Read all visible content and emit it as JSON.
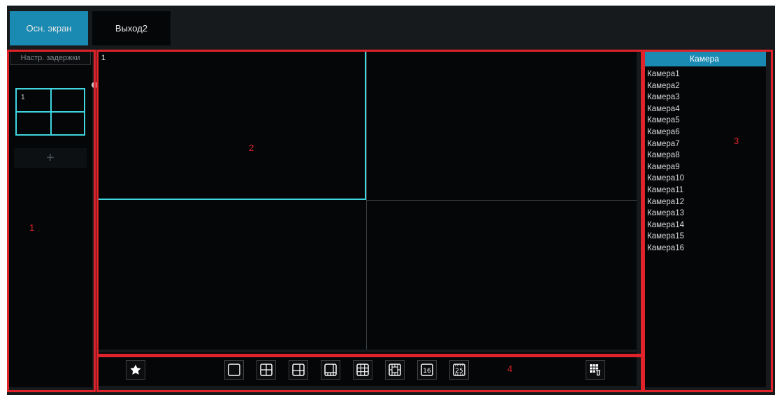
{
  "tabs": [
    {
      "label": "Осн. экран",
      "active": true
    },
    {
      "label": "Выход2",
      "active": false
    }
  ],
  "left_panel": {
    "delay_button": "Настр. задержки",
    "layout_thumb_number": "1",
    "add_icon": "plus-icon",
    "remove_icon": "close-icon"
  },
  "video": {
    "layout": "2x2",
    "cells": [
      {
        "number": "1",
        "selected": true
      },
      {
        "number": "",
        "selected": false
      },
      {
        "number": "",
        "selected": false
      },
      {
        "number": "",
        "selected": false
      }
    ]
  },
  "camera_panel": {
    "header": "Камера",
    "cameras": [
      "Камера1",
      "Камера2",
      "Камера3",
      "Камера4",
      "Камера5",
      "Камера6",
      "Камера7",
      "Камера8",
      "Камера9",
      "Камера10",
      "Камера11",
      "Камера12",
      "Камера13",
      "Камера14",
      "Камера15",
      "Камера16"
    ]
  },
  "toolbar": {
    "buttons": [
      "star-icon",
      "layout-1-icon",
      "layout-4-icon",
      "layout-6-icon",
      "layout-8-icon",
      "layout-9-icon",
      "layout-13-icon",
      "layout-16-icon",
      "layout-25-icon",
      "clear-icon"
    ],
    "layout16_label": "16",
    "layout25_label": "25"
  },
  "annotations": {
    "label1": "1",
    "label2": "2",
    "label3": "3",
    "label4": "4"
  },
  "colors": {
    "accent": "#1a8ab3",
    "selection": "#3fd6e0",
    "annotation_red": "#e0232a",
    "background": "#171a1c",
    "panel": "#050607"
  }
}
